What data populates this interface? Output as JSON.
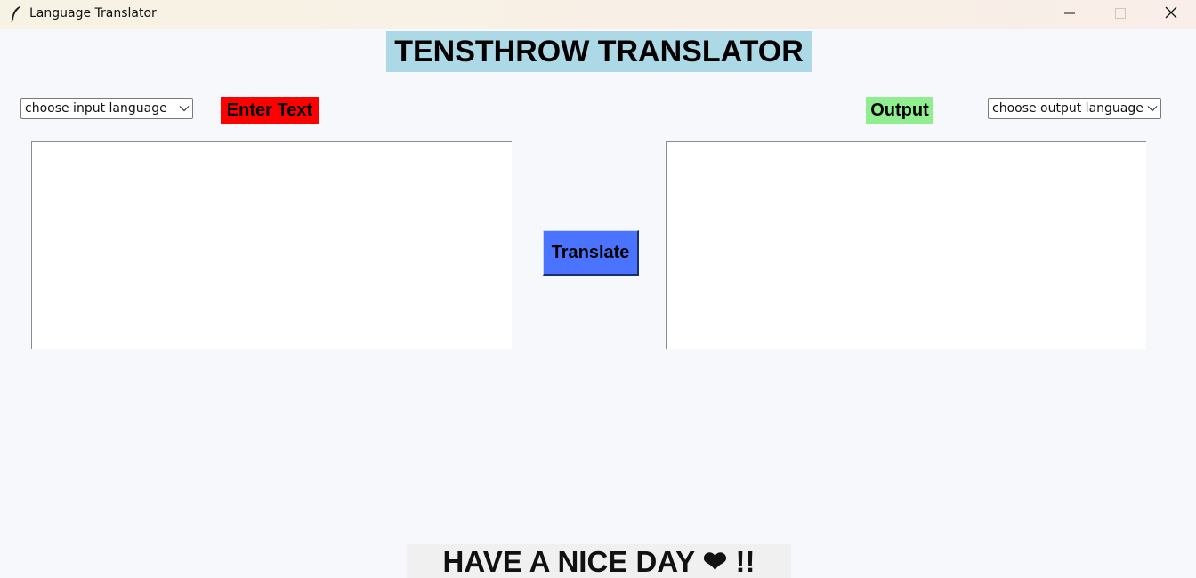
{
  "window": {
    "title": "Language Translator",
    "icons": {
      "app": "feather-icon",
      "minimize": "minimize-icon",
      "maximize": "maximize-icon",
      "close": "close-icon"
    }
  },
  "main": {
    "heading": "TENSTHROW TRANSLATOR",
    "input_language": {
      "selected": "choose input language",
      "icon": "chevron-down-icon"
    },
    "output_language": {
      "selected": "choose output language",
      "icon": "chevron-down-icon"
    },
    "input_label": "Enter Text",
    "output_label": "Output",
    "input_text": "",
    "output_text": "",
    "translate_button": "Translate",
    "footer": "HAVE A NICE DAY ❤   !!"
  },
  "colors": {
    "heading_bg": "#add8e6",
    "input_label_bg": "#ff0000",
    "output_label_bg": "#90ee90",
    "translate_button_bg": "#4a74ff",
    "window_bg": "#f7f8fc"
  }
}
